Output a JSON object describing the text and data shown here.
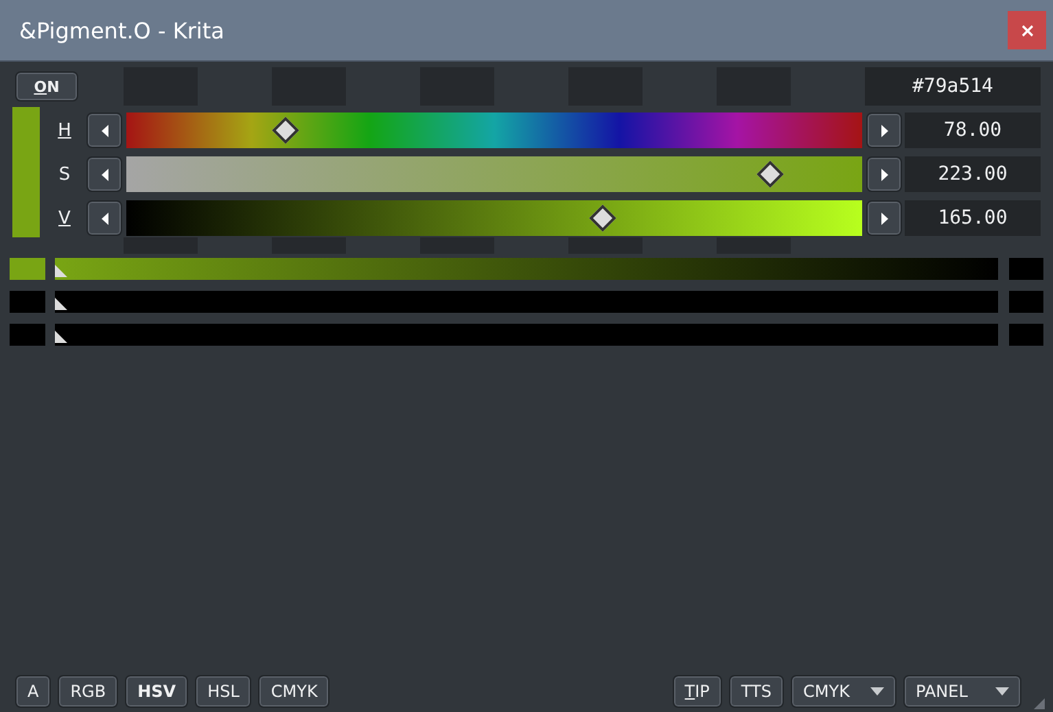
{
  "window": {
    "title": "&Pigment.O - Krita"
  },
  "on_button": {
    "label": "ON",
    "underlined_first": true
  },
  "hex_value": "#79a514",
  "channels": [
    {
      "label": "H",
      "underlined": true,
      "kind": "hue",
      "level": 0.217,
      "reading": "78.00"
    },
    {
      "label": "S",
      "underlined": false,
      "kind": "saturation",
      "level": 0.875,
      "reading": "223.00"
    },
    {
      "label": "V",
      "underlined": true,
      "kind": "value",
      "level": 0.647,
      "reading": "165.00"
    }
  ],
  "mixers": [
    {
      "start": {
        "color": "#79a514"
      },
      "end": {
        "color": "#000000"
      },
      "level": 0
    },
    {
      "start": {
        "color": "#000000"
      },
      "end": {
        "color": "#000000"
      },
      "level": 0
    },
    {
      "start": {
        "color": "#000000"
      },
      "end": {
        "color": "#000000"
      },
      "level": 0
    }
  ],
  "mode_buttons": [
    {
      "label": "A",
      "selected": false
    },
    {
      "label": "RGB",
      "selected": false
    },
    {
      "label": "HSV",
      "selected": true
    },
    {
      "label": "HSL",
      "selected": false
    },
    {
      "label": "CMYK",
      "selected": false
    }
  ],
  "right_buttons": [
    {
      "label": "TIP",
      "kind": "button",
      "underlined_first": true
    },
    {
      "label": "TTS",
      "kind": "button",
      "underlined_first": false
    },
    {
      "label": "CMYK",
      "kind": "dropdown",
      "underlined_first": false
    },
    {
      "label": "PANEL",
      "kind": "dropdown",
      "underlined_first": false
    }
  ]
}
